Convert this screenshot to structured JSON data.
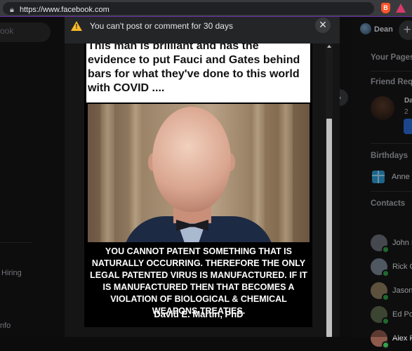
{
  "browser": {
    "url": "https://www.facebook.com",
    "brave_shield_label": "B"
  },
  "facebook": {
    "search_placeholder_fragment": "ook",
    "left_nav": {
      "hiring_label": "Hiring",
      "info_label": "nfo"
    },
    "profile": {
      "name": "Dean",
      "create_symbol": "+"
    },
    "feed_nav_symbol": "›",
    "right_panel": {
      "your_pages_heading": "Your Pages",
      "friend_requests_heading": "Friend Requ",
      "friend_request": {
        "name": "Da",
        "subtitle": "2"
      },
      "birthdays_heading": "Birthdays",
      "birthday_text": "Anne",
      "contacts_heading": "Contacts",
      "contacts": [
        {
          "name": "John I",
          "avatar_color": "#6a6f78"
        },
        {
          "name": "Rick C",
          "avatar_color": "#7a8696"
        },
        {
          "name": "Jason",
          "avatar_color": "#8c7d5e"
        },
        {
          "name": "Ed Por",
          "avatar_color": "#5d6a4c"
        },
        {
          "name": "Alex F",
          "avatar_color": "#8e5a4b"
        }
      ]
    }
  },
  "modal": {
    "title": "You can't post or comment for 30 days",
    "warning_icon": "warning-triangle-icon",
    "close_symbol": "×",
    "post": {
      "caption": "This man is brilliant and has the evidence to put Fauci and Gates behind bars for what they've done to this world with COVID ....",
      "quote": "YOU CANNOT PATENT SOMETHING THAT IS NATURALLY OCCURRING. THEREFORE THE ONLY LEGAL PATENTED VIRUS IS MANUFACTURED. IF IT IS MANUFACTURED THEN THAT BECOMES A VIOLATION OF BIOLOGICAL & CHEMICAL WEAPONS TREATIES.",
      "author": "David E. Martin, PhD"
    }
  },
  "colors": {
    "accent_purple": "#6b2fb0",
    "warning_yellow": "#f7b928",
    "online_green": "#31a24c",
    "fb_blue": "#2d6bd6"
  }
}
